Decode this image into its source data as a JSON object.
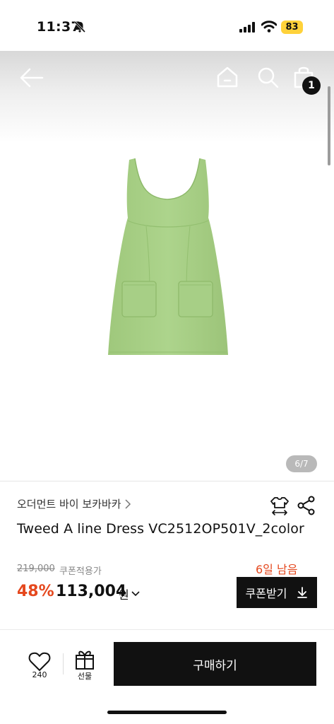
{
  "status_bar": {
    "time": "11:37",
    "battery": "83"
  },
  "product_image": {
    "counter": "6/7"
  },
  "cart": {
    "badge_count": "1"
  },
  "product": {
    "brand": "오더먼트 바이 보카바카",
    "title": "Tweed A line Dress VC2512OP501V_2color",
    "original_price": "219,000",
    "coupon_label": "쿠폰적용가",
    "discount": "48%",
    "price": "113,004",
    "currency": "원",
    "days_left": "6일 남음",
    "coupon_button": "쿠폰받기"
  },
  "bottom_bar": {
    "like_count": "240",
    "gift_label": "선물",
    "buy_label": "구매하기"
  },
  "colors": {
    "accent": "#e5481e",
    "dress": "#a8cf86",
    "primary_button": "#111111"
  }
}
